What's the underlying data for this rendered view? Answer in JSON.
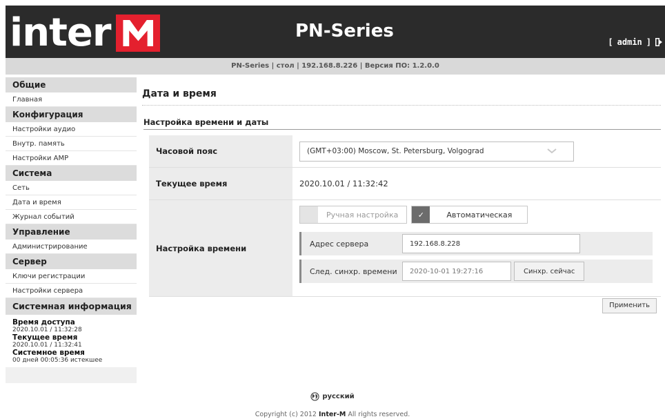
{
  "header": {
    "logo_text": "inter",
    "logo_mark": "M",
    "product_title": "PN-Series",
    "user_open": "[",
    "user": "admin",
    "user_close": "]",
    "logout_icon": "logout-icon"
  },
  "subheader": {
    "text": "PN-Series | стол | 192.168.8.226 | Версия ПО: 1.2.0.0"
  },
  "sidebar": {
    "general": {
      "title": "Общие",
      "items": [
        "Главная"
      ]
    },
    "config": {
      "title": "Конфигурация",
      "items": [
        "Настройки аудио",
        "Внутр. память",
        "Настройки АМР"
      ]
    },
    "system": {
      "title": "Система",
      "items": [
        "Сеть",
        "Дата и время",
        "Журнал событий"
      ]
    },
    "manage": {
      "title": "Управление",
      "items": [
        "Администрирование"
      ]
    },
    "server": {
      "title": "Сервер",
      "items": [
        "Ключи регистрации",
        "Настройки сервера"
      ]
    },
    "sysinfo": {
      "title": "Системная информация",
      "access_label": "Время доступа",
      "access_value": "2020.10.01 / 11:32:28",
      "current_label": "Текущее время",
      "current_value": "2020.10.01 / 11:32:41",
      "system_label": "Системное время",
      "system_value": "00 дней 00:05:36 истекшее"
    }
  },
  "main": {
    "page_title": "Дата и время",
    "section_title": "Настройка времени и даты",
    "timezone_label": "Часовой пояс",
    "timezone_value": "(GMT+03:00) Moscow, St. Petersburg, Volgograd",
    "current_time_label": "Текущее время",
    "current_time_value": "2020.10.01 / 11:32:42",
    "time_setting_label": "Настройка времени",
    "manual_label": "Ручная настройка",
    "auto_label": "Автоматическая",
    "check_mark": "✓",
    "server_label": "Адрес сервера",
    "server_value": "192.168.8.228",
    "next_sync_label": "След. синхр. времени",
    "next_sync_value": "2020-10-01 19:27:16",
    "sync_now_label": "Синхр. сейчас",
    "apply_label": "Применить"
  },
  "footer": {
    "language": "русский",
    "copyright_prefix": "Copyright (c) 2012",
    "copyright_brand": "Inter-M",
    "copyright_suffix": "All rights reserved."
  },
  "colors": {
    "header_bg": "#2b2b2b",
    "logo_red": "#e4202e",
    "subheader_bg": "#d9d9d9",
    "sidebar_head_bg": "#dcdcdc",
    "label_bg": "#ececec"
  }
}
